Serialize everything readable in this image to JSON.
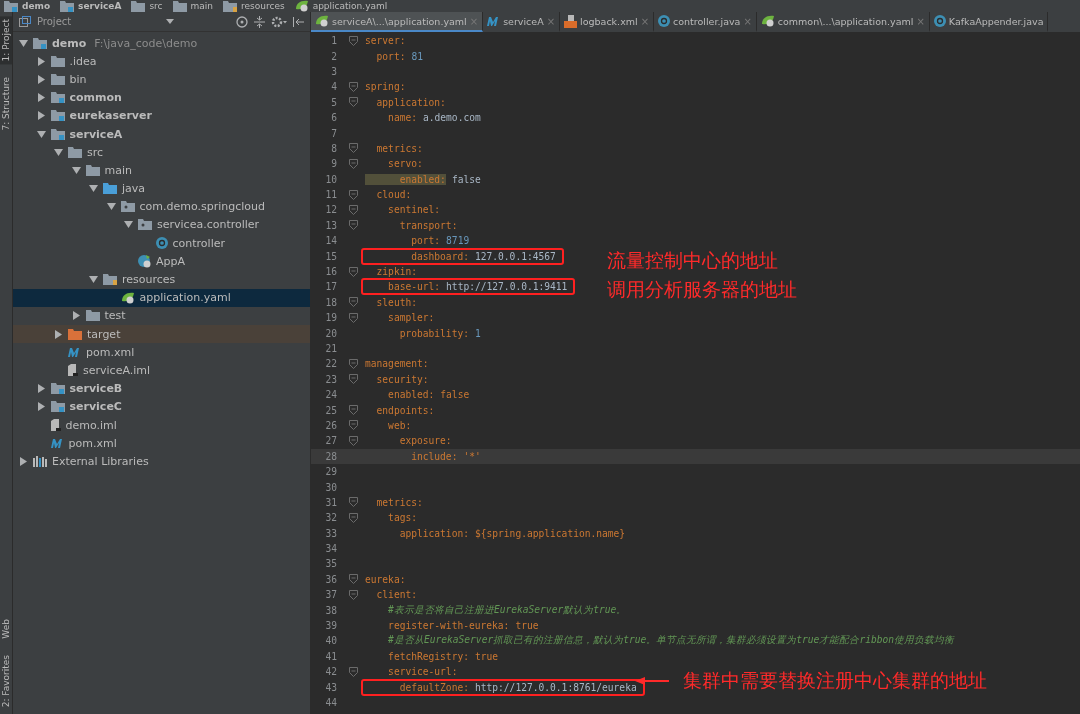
{
  "breadcrumbs": [
    {
      "label": "demo",
      "kind": "module"
    },
    {
      "label": "serviceA",
      "kind": "module"
    },
    {
      "label": "src",
      "kind": "folder"
    },
    {
      "label": "main",
      "kind": "folder"
    },
    {
      "label": "resources",
      "kind": "resources"
    },
    {
      "label": "application.yaml",
      "kind": "yaml"
    }
  ],
  "tool_strip": {
    "top": [
      {
        "label": "1: Project",
        "selected": true
      },
      {
        "label": "7: Structure",
        "selected": false
      }
    ],
    "bottom": [
      {
        "label": "Web",
        "selected": false
      },
      {
        "label": "2: Favorites",
        "selected": false
      }
    ]
  },
  "project_panel": {
    "title": "Project",
    "tree": [
      {
        "label": "demo",
        "path": "F:\\java_code\\demo",
        "kind": "module",
        "expanded": true,
        "selected": false,
        "children": [
          {
            "label": ".idea",
            "kind": "folder",
            "expanded": false,
            "selected": false
          },
          {
            "label": "bin",
            "kind": "folder",
            "expanded": false,
            "selected": false
          },
          {
            "label": "common",
            "kind": "module",
            "expanded": false,
            "selected": false
          },
          {
            "label": "eurekaserver",
            "kind": "module",
            "expanded": false,
            "selected": false
          },
          {
            "label": "serviceA",
            "kind": "module",
            "expanded": true,
            "selected": false,
            "children": [
              {
                "label": "src",
                "kind": "folder",
                "expanded": true,
                "selected": false,
                "children": [
                  {
                    "label": "main",
                    "kind": "folder",
                    "expanded": true,
                    "selected": false,
                    "children": [
                      {
                        "label": "java",
                        "kind": "source",
                        "expanded": true,
                        "selected": false,
                        "children": [
                          {
                            "label": "com.demo.springcloud",
                            "kind": "package",
                            "expanded": true,
                            "selected": false,
                            "children": [
                              {
                                "label": "servicea.controller",
                                "kind": "package",
                                "expanded": true,
                                "selected": false,
                                "children": [
                                  {
                                    "label": "controller",
                                    "kind": "class",
                                    "selected": false
                                  }
                                ]
                              },
                              {
                                "label": "AppA",
                                "kind": "springclass",
                                "selected": false
                              }
                            ]
                          }
                        ]
                      },
                      {
                        "label": "resources",
                        "kind": "resources",
                        "expanded": true,
                        "selected": false,
                        "children": [
                          {
                            "label": "application.yaml",
                            "kind": "yaml",
                            "selected": true
                          }
                        ]
                      }
                    ]
                  },
                  {
                    "label": "test",
                    "kind": "folder",
                    "expanded": false,
                    "selected": false
                  }
                ]
              },
              {
                "label": "target",
                "kind": "excluded",
                "expanded": false,
                "selected": false
              },
              {
                "label": "pom.xml",
                "kind": "maven",
                "selected": false
              },
              {
                "label": "serviceA.iml",
                "kind": "iml",
                "selected": false
              }
            ]
          },
          {
            "label": "serviceB",
            "kind": "module",
            "expanded": false,
            "selected": false
          },
          {
            "label": "serviceC",
            "kind": "module",
            "expanded": false,
            "selected": false
          },
          {
            "label": "demo.iml",
            "kind": "iml",
            "selected": false
          },
          {
            "label": "pom.xml",
            "kind": "maven",
            "selected": false
          }
        ]
      },
      {
        "label": "External Libraries",
        "kind": "libraries",
        "expanded": false,
        "selected": false
      }
    ]
  },
  "tabs": [
    {
      "label": "serviceA\\...\\application.yaml",
      "close": "×",
      "kind": "yaml",
      "selected": true
    },
    {
      "label": "serviceA",
      "close": "×",
      "kind": "maven",
      "selected": false
    },
    {
      "label": "logback.xml",
      "close": "×",
      "kind": "xml",
      "selected": false
    },
    {
      "label": "controller.java",
      "close": "×",
      "kind": "class",
      "selected": false
    },
    {
      "label": "common\\...\\application.yaml",
      "close": "×",
      "kind": "yaml",
      "selected": false
    },
    {
      "label": "KafkaAppender.java",
      "kind": "class",
      "selected": false
    }
  ],
  "editor": {
    "lines": [
      {
        "num": "1",
        "kind": "key",
        "key": "server:",
        "highlighted": false,
        "current": false,
        "boxed": false
      },
      {
        "num": "2",
        "kind": "number",
        "key": "  port:",
        "value": "81",
        "highlighted": false,
        "current": false,
        "boxed": false
      },
      {
        "num": "3",
        "kind": "blank",
        "highlighted": false,
        "current": false,
        "boxed": false
      },
      {
        "num": "4",
        "kind": "key",
        "key": "spring:",
        "highlighted": false,
        "current": false,
        "boxed": false
      },
      {
        "num": "5",
        "kind": "key",
        "key": "  application:",
        "highlighted": false,
        "current": false,
        "boxed": false
      },
      {
        "num": "6",
        "kind": "text",
        "key": "    name:",
        "value": "a.demo.com",
        "highlighted": false,
        "current": false,
        "boxed": false
      },
      {
        "num": "7",
        "kind": "blank",
        "highlighted": false,
        "current": false,
        "boxed": false
      },
      {
        "num": "8",
        "kind": "key",
        "key": "  metrics:",
        "highlighted": false,
        "current": false,
        "boxed": false
      },
      {
        "num": "9",
        "kind": "key",
        "key": "    servo:",
        "highlighted": false,
        "current": false,
        "boxed": false
      },
      {
        "num": "10",
        "kind": "text",
        "key": "      enabled:",
        "value": "false",
        "highlighted": true,
        "current": false,
        "boxed": false
      },
      {
        "num": "11",
        "kind": "key",
        "key": "  cloud:",
        "highlighted": false,
        "current": false,
        "boxed": false
      },
      {
        "num": "12",
        "kind": "key",
        "key": "    sentinel:",
        "highlighted": false,
        "current": false,
        "boxed": false
      },
      {
        "num": "13",
        "kind": "key",
        "key": "      transport:",
        "highlighted": false,
        "current": false,
        "boxed": false
      },
      {
        "num": "14",
        "kind": "number",
        "key": "        port:",
        "value": "8719",
        "highlighted": false,
        "current": false,
        "boxed": false
      },
      {
        "num": "15",
        "kind": "text",
        "key": "        dashboard:",
        "value": "127.0.0.1:4567",
        "highlighted": false,
        "current": false,
        "boxed": true
      },
      {
        "num": "16",
        "kind": "key",
        "key": "  zipkin:",
        "highlighted": false,
        "current": false,
        "boxed": false
      },
      {
        "num": "17",
        "kind": "text",
        "key": "    base-url:",
        "value": "http://127.0.0.1:9411",
        "highlighted": false,
        "current": false,
        "boxed": true
      },
      {
        "num": "18",
        "kind": "key",
        "key": "  sleuth:",
        "highlighted": false,
        "current": false,
        "boxed": false
      },
      {
        "num": "19",
        "kind": "key",
        "key": "    sampler:",
        "highlighted": false,
        "current": false,
        "boxed": false
      },
      {
        "num": "20",
        "kind": "number",
        "key": "      probability:",
        "value": "1",
        "highlighted": false,
        "current": false,
        "boxed": false
      },
      {
        "num": "21",
        "kind": "blank",
        "highlighted": false,
        "current": false,
        "boxed": false
      },
      {
        "num": "22",
        "kind": "key",
        "key": "management:",
        "highlighted": false,
        "current": false,
        "boxed": false
      },
      {
        "num": "23",
        "kind": "key",
        "key": "  security:",
        "highlighted": false,
        "current": false,
        "boxed": false
      },
      {
        "num": "24",
        "kind": "keyword",
        "key": "    enabled:",
        "value": "false",
        "highlighted": false,
        "current": false,
        "boxed": false
      },
      {
        "num": "25",
        "kind": "key",
        "key": "  endpoints:",
        "highlighted": false,
        "current": false,
        "boxed": false
      },
      {
        "num": "26",
        "kind": "key",
        "key": "    web:",
        "highlighted": false,
        "current": false,
        "boxed": false
      },
      {
        "num": "27",
        "kind": "key",
        "key": "      exposure:",
        "highlighted": false,
        "current": false,
        "boxed": false
      },
      {
        "num": "28",
        "kind": "keyword",
        "key": "        include:",
        "value": "'*'",
        "highlighted": false,
        "current": true,
        "boxed": false
      },
      {
        "num": "29",
        "kind": "blank",
        "highlighted": false,
        "current": false,
        "boxed": false
      },
      {
        "num": "30",
        "kind": "blank",
        "highlighted": false,
        "current": false,
        "boxed": false
      },
      {
        "num": "31",
        "kind": "key",
        "key": "  metrics:",
        "highlighted": false,
        "current": false,
        "boxed": false
      },
      {
        "num": "32",
        "kind": "key",
        "key": "    tags:",
        "highlighted": false,
        "current": false,
        "boxed": false
      },
      {
        "num": "33",
        "kind": "keyword",
        "key": "      application:",
        "value": "${spring.application.name}",
        "highlighted": false,
        "current": false,
        "boxed": false
      },
      {
        "num": "34",
        "kind": "blank",
        "highlighted": false,
        "current": false,
        "boxed": false
      },
      {
        "num": "35",
        "kind": "blank",
        "highlighted": false,
        "current": false,
        "boxed": false
      },
      {
        "num": "36",
        "kind": "key",
        "key": "eureka:",
        "highlighted": false,
        "current": false,
        "boxed": false
      },
      {
        "num": "37",
        "kind": "key",
        "key": "  client:",
        "highlighted": false,
        "current": false,
        "boxed": false
      },
      {
        "num": "38",
        "kind": "comment",
        "key": "    #表示是否将自己注册进EurekaServer默认为true。",
        "highlighted": false,
        "current": false,
        "boxed": false
      },
      {
        "num": "39",
        "kind": "keyword",
        "key": "    register-with-eureka:",
        "value": "true",
        "highlighted": false,
        "current": false,
        "boxed": false
      },
      {
        "num": "40",
        "kind": "comment",
        "key": "    #是否从EurekaServer抓取已有的注册信息，默认为true。单节点无所谓，集群必须设置为true才能配合ribbon使用负载均衡",
        "highlighted": false,
        "current": false,
        "boxed": false
      },
      {
        "num": "41",
        "kind": "keyword",
        "key": "    fetchRegistry:",
        "value": "true",
        "highlighted": false,
        "current": false,
        "boxed": false
      },
      {
        "num": "42",
        "kind": "key",
        "key": "    service-url:",
        "highlighted": false,
        "current": false,
        "boxed": false
      },
      {
        "num": "43",
        "kind": "text",
        "key": "      defaultZone:",
        "value": "http://127.0.0.1:8761/eureka",
        "highlighted": false,
        "current": false,
        "boxed": true
      },
      {
        "num": "44",
        "kind": "blank",
        "highlighted": false,
        "current": false,
        "boxed": false
      }
    ],
    "annotations": [
      {
        "text": "流量控制中心的地址",
        "kind": "side"
      },
      {
        "text": "调用分析服务器的地址",
        "kind": "side"
      },
      {
        "text": "集群中需要替换注册中心集群的地址",
        "kind": "arrow"
      }
    ]
  }
}
